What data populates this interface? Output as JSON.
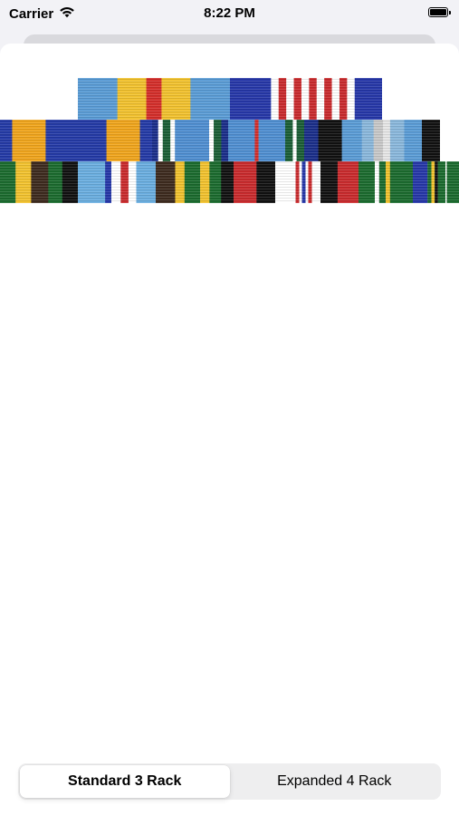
{
  "status_bar": {
    "carrier": "Carrier",
    "time": "8:22 PM"
  },
  "segmented_control": {
    "options": [
      "Standard 3 Rack",
      "Expanded 4 Rack"
    ],
    "selected_index": 0
  },
  "ribbons": {
    "row1": [
      {
        "name": "ribbon-1-1",
        "stripes": [
          [
            "#5a9cd6",
            0.26
          ],
          [
            "#f2c22e",
            0.19
          ],
          [
            "#d42e2a",
            0.1
          ],
          [
            "#f2c22e",
            0.19
          ],
          [
            "#5a9cd6",
            0.26
          ]
        ]
      },
      {
        "name": "ribbon-1-2",
        "stripes": [
          [
            "#2637a8",
            0.27
          ],
          [
            "#ffffff",
            0.05
          ],
          [
            "#c92a2d",
            0.05
          ],
          [
            "#ffffff",
            0.05
          ],
          [
            "#c92a2d",
            0.05
          ],
          [
            "#ffffff",
            0.05
          ],
          [
            "#c92a2d",
            0.05
          ],
          [
            "#ffffff",
            0.05
          ],
          [
            "#c92a2d",
            0.05
          ],
          [
            "#ffffff",
            0.05
          ],
          [
            "#c92a2d",
            0.05
          ],
          [
            "#ffffff",
            0.05
          ],
          [
            "#2637a8",
            0.28
          ]
        ]
      }
    ],
    "row2": [
      {
        "name": "ribbon-2-1",
        "stripes": [
          [
            "#243aa6",
            0.08
          ],
          [
            "#f0a51c",
            0.22
          ],
          [
            "#243aa6",
            0.4
          ],
          [
            "#f0a51c",
            0.22
          ],
          [
            "#243aa6",
            0.08
          ]
        ]
      },
      {
        "name": "ribbon-2-2",
        "stripes": [
          [
            "#1a2e8a",
            0.08
          ],
          [
            "#ffffff",
            0.06
          ],
          [
            "#1b5e35",
            0.1
          ],
          [
            "#ffffff",
            0.06
          ],
          [
            "#4f8fd1",
            0.45
          ],
          [
            "#ffffff",
            0.06
          ],
          [
            "#1b5e35",
            0.1
          ],
          [
            "#1a2e8a",
            0.09
          ]
        ]
      },
      {
        "name": "ribbon-2-3",
        "stripes": [
          [
            "#4f8fd1",
            0.35
          ],
          [
            "#d42e2a",
            0.05
          ],
          [
            "#4f8fd1",
            0.35
          ],
          [
            "#1b5e35",
            0.1
          ],
          [
            "#ffffff",
            0.05
          ],
          [
            "#1b5e35",
            0.1
          ]
        ]
      },
      {
        "name": "ribbon-2-4",
        "stripes": [
          [
            "#1a2e8a",
            0.12
          ],
          [
            "#111111",
            0.2
          ],
          [
            "#5a9cd6",
            0.17
          ],
          [
            "#8ab8dc",
            0.1
          ],
          [
            "#c8c8c8",
            0.08
          ],
          [
            "#e6e6e6",
            0.06
          ],
          [
            "#8ab8dc",
            0.12
          ],
          [
            "#5a9cd6",
            0.15
          ]
        ]
      },
      {
        "name": "ribbon-2-5",
        "stripes": [
          [
            "#111111",
            1
          ]
        ]
      }
    ],
    "row3": [
      {
        "name": "ribbon-3-1",
        "stripes": [
          [
            "#1b6b2e",
            0.2
          ],
          [
            "#f2c22e",
            0.2
          ],
          [
            "#3d2a1e",
            0.22
          ],
          [
            "#1b6b2e",
            0.18
          ],
          [
            "#111111",
            0.2
          ]
        ]
      },
      {
        "name": "ribbon-3-2",
        "stripes": [
          [
            "#6aaee0",
            0.35
          ],
          [
            "#2637a8",
            0.08
          ],
          [
            "#ffffff",
            0.12
          ],
          [
            "#c92a2d",
            0.1
          ],
          [
            "#ffffff",
            0.1
          ],
          [
            "#6aaee0",
            0.25
          ]
        ]
      },
      {
        "name": "ribbon-3-3",
        "stripes": [
          [
            "#3d2a1e",
            0.25
          ],
          [
            "#f2c22e",
            0.12
          ],
          [
            "#1b6b2e",
            0.2
          ],
          [
            "#f2c22e",
            0.12
          ],
          [
            "#1b6b2e",
            0.15
          ],
          [
            "#111111",
            0.16
          ]
        ]
      },
      {
        "name": "ribbon-3-4",
        "stripes": [
          [
            "#c92a2d",
            0.55
          ],
          [
            "#111111",
            0.45
          ]
        ]
      },
      {
        "name": "ribbon-3-5",
        "stripes": [
          [
            "#ffffff",
            0.45
          ],
          [
            "#c92a2d",
            0.08
          ],
          [
            "#ffffff",
            0.06
          ],
          [
            "#2637a8",
            0.08
          ],
          [
            "#ffffff",
            0.06
          ],
          [
            "#c92a2d",
            0.08
          ],
          [
            "#ffffff",
            0.19
          ]
        ]
      },
      {
        "name": "ribbon-3-6",
        "stripes": [
          [
            "#111111",
            0.45
          ],
          [
            "#c92a2d",
            0.55
          ]
        ]
      },
      {
        "name": "ribbon-3-7",
        "stripes": [
          [
            "#1b6b2e",
            0.3
          ],
          [
            "#ffffff",
            0.08
          ],
          [
            "#1b6b2e",
            0.12
          ],
          [
            "#f2c22e",
            0.08
          ],
          [
            "#1b6b2e",
            0.42
          ]
        ]
      },
      {
        "name": "ribbon-3-8",
        "stripes": [
          [
            "#2637a8",
            0.45
          ],
          [
            "#1b6b2e",
            0.12
          ],
          [
            "#f2c22e",
            0.1
          ],
          [
            "#111111",
            0.1
          ],
          [
            "#1b6b2e",
            0.23
          ]
        ]
      },
      {
        "name": "ribbon-3-9",
        "stripes": [
          [
            "#ffffff",
            0.1
          ],
          [
            "#1b6b2e",
            0.9
          ]
        ]
      }
    ]
  }
}
